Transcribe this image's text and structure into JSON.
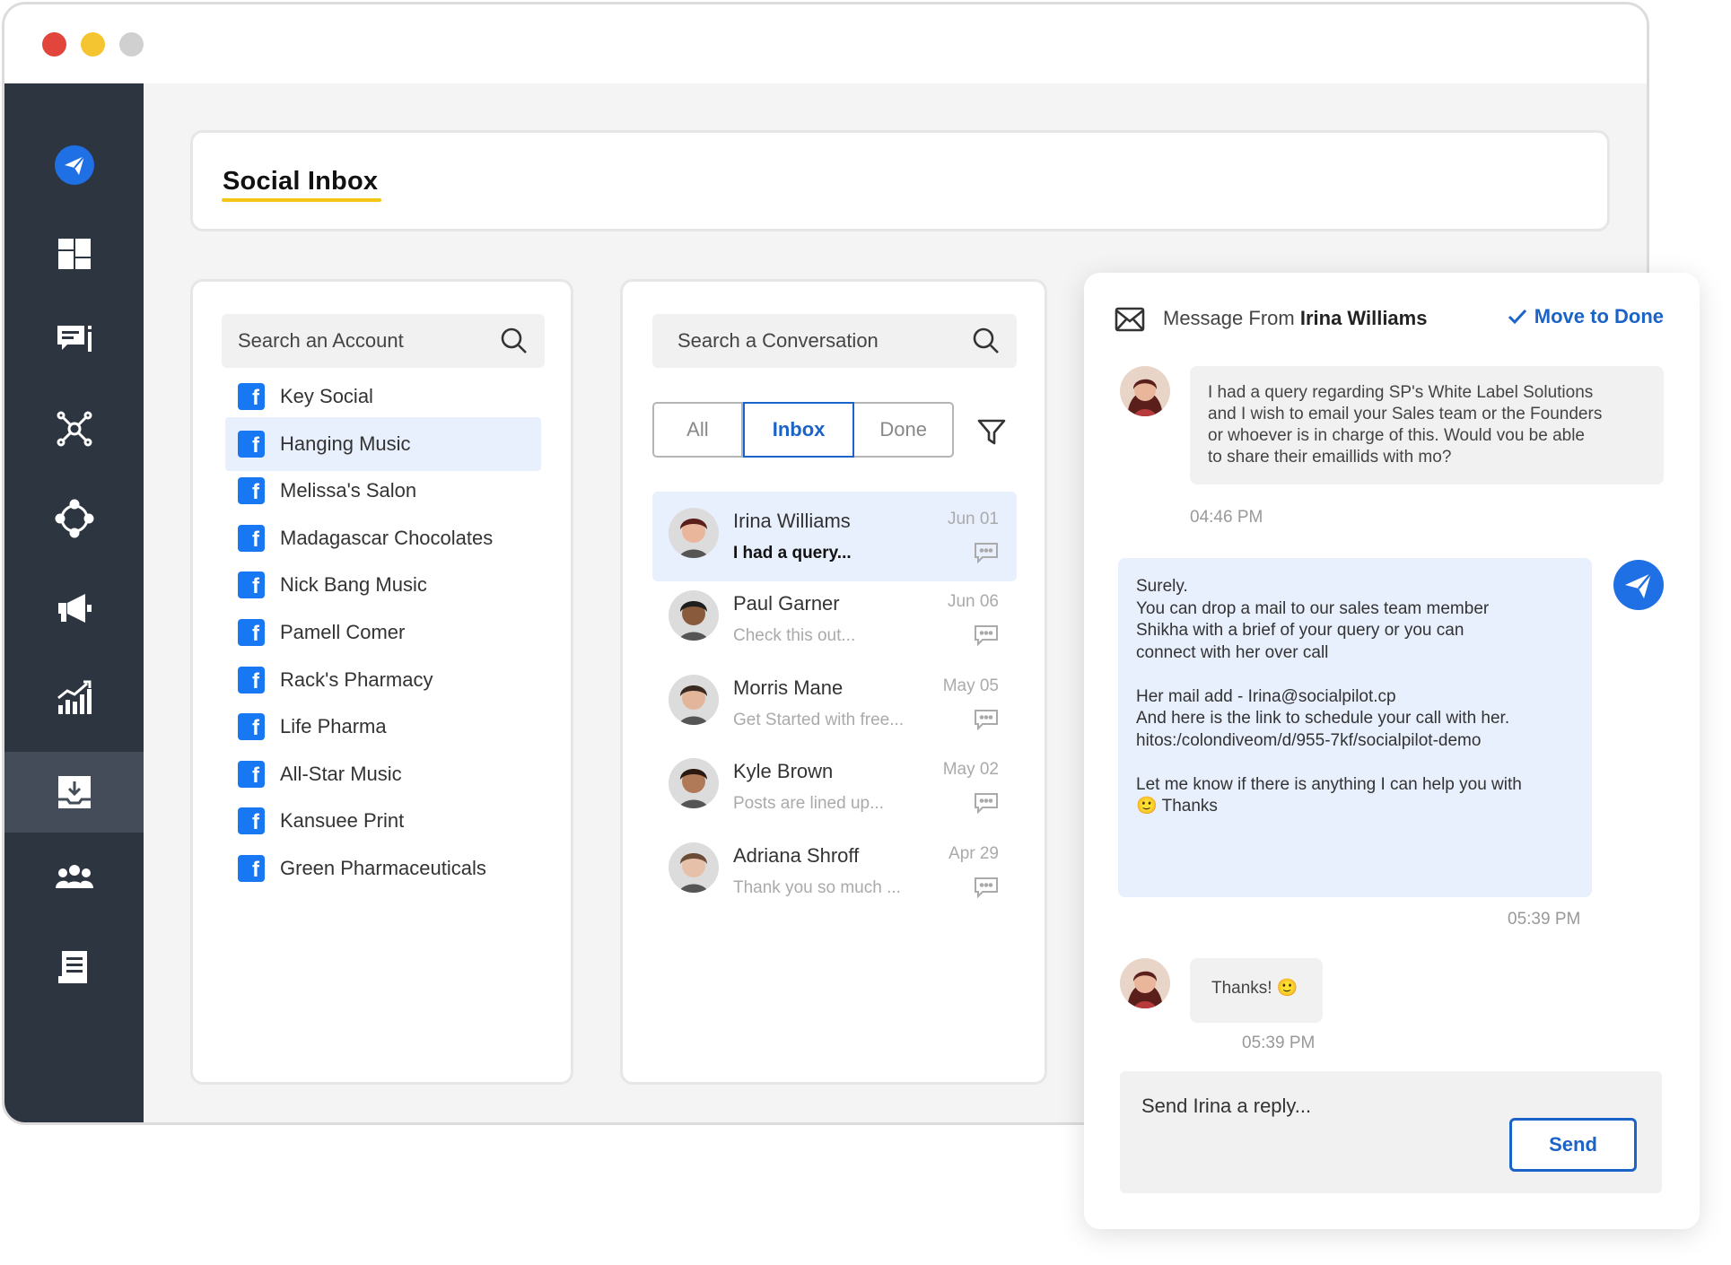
{
  "window": {
    "controls": [
      "close",
      "minimize",
      "maximize"
    ]
  },
  "sidebar": {
    "items": [
      {
        "icon": "send-logo-icon",
        "active": false
      },
      {
        "icon": "dashboard-icon",
        "active": false
      },
      {
        "icon": "posts-icon",
        "active": false
      },
      {
        "icon": "connections-icon",
        "active": false
      },
      {
        "icon": "integrations-icon",
        "active": false
      },
      {
        "icon": "megaphone-icon",
        "active": false
      },
      {
        "icon": "analytics-icon",
        "active": false
      },
      {
        "icon": "inbox-icon",
        "active": true
      },
      {
        "icon": "team-icon",
        "active": false
      },
      {
        "icon": "reports-icon",
        "active": false
      }
    ]
  },
  "header": {
    "title": "Social Inbox",
    "accent_color": "#f5c518"
  },
  "accounts": {
    "search_placeholder": "Search an Account",
    "items": [
      {
        "label": "Key Social",
        "active": false
      },
      {
        "label": "Hanging Music",
        "active": true
      },
      {
        "label": "Melissa's Salon",
        "active": false
      },
      {
        "label": "Madagascar Chocolates",
        "active": false
      },
      {
        "label": "Nick Bang Music",
        "active": false
      },
      {
        "label": "Pamell Comer",
        "active": false
      },
      {
        "label": "Rack's Pharmacy",
        "active": false
      },
      {
        "label": "Life Pharma",
        "active": false
      },
      {
        "label": "All-Star Music",
        "active": false
      },
      {
        "label": "Kansuee Print",
        "active": false
      },
      {
        "label": "Green Pharmaceuticals",
        "active": false
      }
    ]
  },
  "conversations": {
    "search_placeholder": "Search a Conversation",
    "tabs": [
      {
        "label": "All",
        "active": false
      },
      {
        "label": "Inbox",
        "active": true
      },
      {
        "label": "Done",
        "active": false
      }
    ],
    "items": [
      {
        "name": "Irina Williams",
        "preview": "I had a query...",
        "date": "Jun 01",
        "active": true
      },
      {
        "name": "Paul Garner",
        "preview": "Check this out...",
        "date": "Jun 06",
        "active": false
      },
      {
        "name": "Morris Mane",
        "preview": "Get Started with free...",
        "date": "May 05",
        "active": false
      },
      {
        "name": "Kyle Brown",
        "preview": "Posts are lined up...",
        "date": "May 02",
        "active": false
      },
      {
        "name": "Adriana Shroff",
        "preview": "Thank you so much ...",
        "date": "Apr 29",
        "active": false
      }
    ]
  },
  "message": {
    "from_prefix": "Message From",
    "from_name": "Irina Williams",
    "move_to_done": "Move to Done",
    "thread": [
      {
        "direction": "in",
        "lines": [
          "I had a query regarding SP's White Label Solutions",
          "and I wish to email your Sales team or the Founders",
          "or whoever is in charge of this. Would vou be able",
          "to share their emaillids with mo?"
        ],
        "time": "04:46 PM"
      },
      {
        "direction": "out",
        "lines": [
          "Surely.",
          "You can drop a mail to our sales team member",
          "Shikha with a brief of your query or you can",
          "connect with her over call",
          "",
          "Her mail add - Irina@socialpilot.cp",
          "And here is the link to schedule your call with her.",
          "hitos:/colondiveom/d/955-7kf/socialpilot-demo",
          "",
          "Let me know if there is anything I can help you with",
          "🙂 Thanks"
        ],
        "time": "05:39 PM"
      },
      {
        "direction": "in",
        "lines": [
          "Thanks! 🙂"
        ],
        "time": "05:39 PM"
      }
    ],
    "reply_placeholder": "Send Irina a reply...",
    "send_label": "Send"
  },
  "colors": {
    "primary": "#1b63c7",
    "sidebar_bg": "#2d3540",
    "active_row_bg": "#e8effd"
  }
}
